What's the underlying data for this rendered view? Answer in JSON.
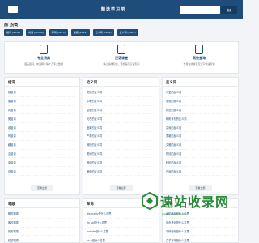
{
  "header": {
    "site_name": "精选学习吧",
    "search_button": "搜索",
    "search_placeholder": ""
  },
  "hot_categories": {
    "title": "热门分类",
    "items": [
      "组词 (4856)",
      "成语 (12588)",
      "释词 (3225)",
      "笔顺 (2841)",
      "近义词 (5432)",
      "反义词 (5381)"
    ]
  },
  "features": [
    {
      "title": "专业词典",
      "desc": "涵盖组词、成语释义等十万专业数据"
    },
    {
      "title": "汉语课堂",
      "desc": "精心编排知识，轻松提高汉语知识"
    },
    {
      "title": "高效查询",
      "desc": "支持在线拼音及汉字快速查询"
    }
  ],
  "panels": {
    "zuci": {
      "title": "组词",
      "items": [
        "娴组词",
        "撮组词",
        "乳组词",
        "樊组词",
        "戚组词",
        "咐组词",
        "翩组词",
        "嘉组词",
        "奠组词",
        "谨组词"
      ],
      "more": "查看全部"
    },
    "jinyici": {
      "title": "近义词",
      "items": [
        "宽恕的近义词",
        "平和的近义词",
        "怠慢的近义词",
        "光芒的近义词",
        "迷离的近义词",
        "严肃的近义词",
        "畅快的近义词",
        "宽阔的近义词",
        "推辞的近义词",
        "疲倦的近义词"
      ],
      "more": "查看全部"
    },
    "fanyici": {
      "title": "反义词",
      "items": [
        "可爱的反义词",
        "遥远的反义词",
        "陈旧的反义词",
        "彬彬有礼的反义词",
        "高尚的反义词",
        "勇敢的反义词",
        "文雅的反义词",
        "热情的反义词",
        "轻松的反义词",
        "开阔的反义词"
      ],
      "more": "查看全部"
    },
    "bishun": {
      "title": "笔顺",
      "items": [
        "聊的笔顺",
        "鹅的笔顺",
        "宛的笔顺",
        "粒的笔顺",
        "琼的笔顺",
        "烦的笔顺",
        "篮的笔顺"
      ]
    },
    "danci": {
      "title": "单词",
      "items": [
        "distinctly是什么意思",
        "fix up是什么意思",
        "jadeite是什么意思",
        "on a是什么意思",
        "whose是什么意思",
        "persistence是什么意思",
        "bright是什么意思"
      ]
    },
    "chengyu": {
      "title": "成语",
      "items": [
        "画蛇添足是什么意思",
        "刻舟求剑是什么意思",
        "守株待兔是什么意思",
        "亡羊补牢是什么意思",
        "杯弓蛇影是什么意思",
        "掩耳盗铃是什么意思",
        "拔苗助长是什么意思"
      ]
    }
  },
  "watermark": {
    "text": "速站收录网",
    "sub": "www.susouzhan.com"
  },
  "colors": {
    "primary": "#1e4d7b",
    "background": "#f2f4f7",
    "watermark": "#2a8a3a"
  }
}
